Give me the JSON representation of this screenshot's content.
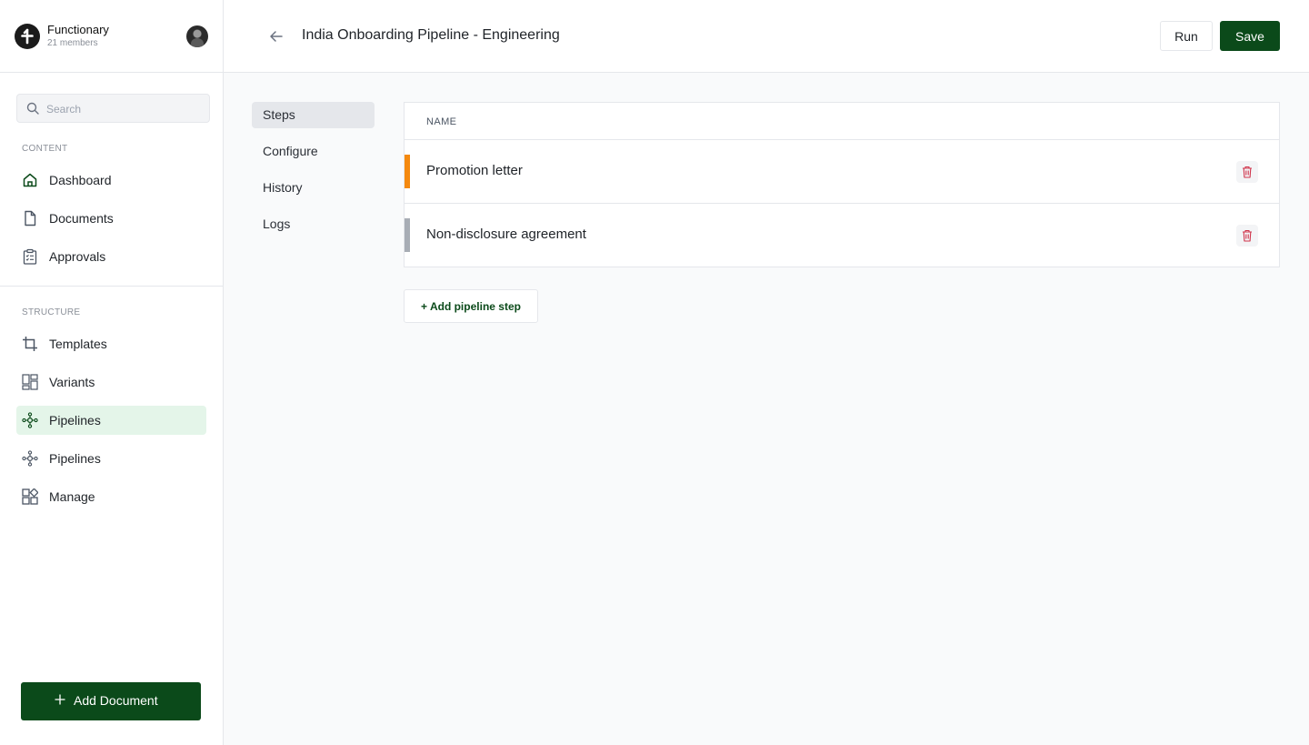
{
  "org": {
    "name": "Functionary",
    "members": "21 members"
  },
  "search": {
    "placeholder": "Search"
  },
  "sidebar": {
    "content_label": "CONTENT",
    "structure_label": "STRUCTURE",
    "content_items": [
      {
        "label": "Dashboard",
        "icon": "home-icon"
      },
      {
        "label": "Documents",
        "icon": "document-icon"
      },
      {
        "label": "Approvals",
        "icon": "clipboard-check-icon"
      }
    ],
    "structure_items": [
      {
        "label": "Templates",
        "icon": "crop-icon"
      },
      {
        "label": "Variants",
        "icon": "layout-icon"
      },
      {
        "label": "Pipelines",
        "icon": "pipeline-icon",
        "active": true
      },
      {
        "label": "Pipelines",
        "icon": "pipeline-icon"
      },
      {
        "label": "Manage",
        "icon": "grid-icon"
      }
    ],
    "add_document": "Add Document"
  },
  "header": {
    "title": "India Onboarding Pipeline - Engineering",
    "run_label": "Run",
    "save_label": "Save"
  },
  "subnav": {
    "items": [
      {
        "label": "Steps",
        "active": true
      },
      {
        "label": "Configure"
      },
      {
        "label": "History"
      },
      {
        "label": "Logs"
      }
    ]
  },
  "table": {
    "column_name": "NAME",
    "rows": [
      {
        "name": "Promotion letter",
        "color": "#f5890f"
      },
      {
        "name": "Non-disclosure agreement",
        "color": "#a8adb5"
      }
    ]
  },
  "add_step_label": "+ Add pipeline step",
  "colors": {
    "brand": "#0b4a1a",
    "active_bg": "#e4f5e9",
    "danger": "#d0344b"
  }
}
